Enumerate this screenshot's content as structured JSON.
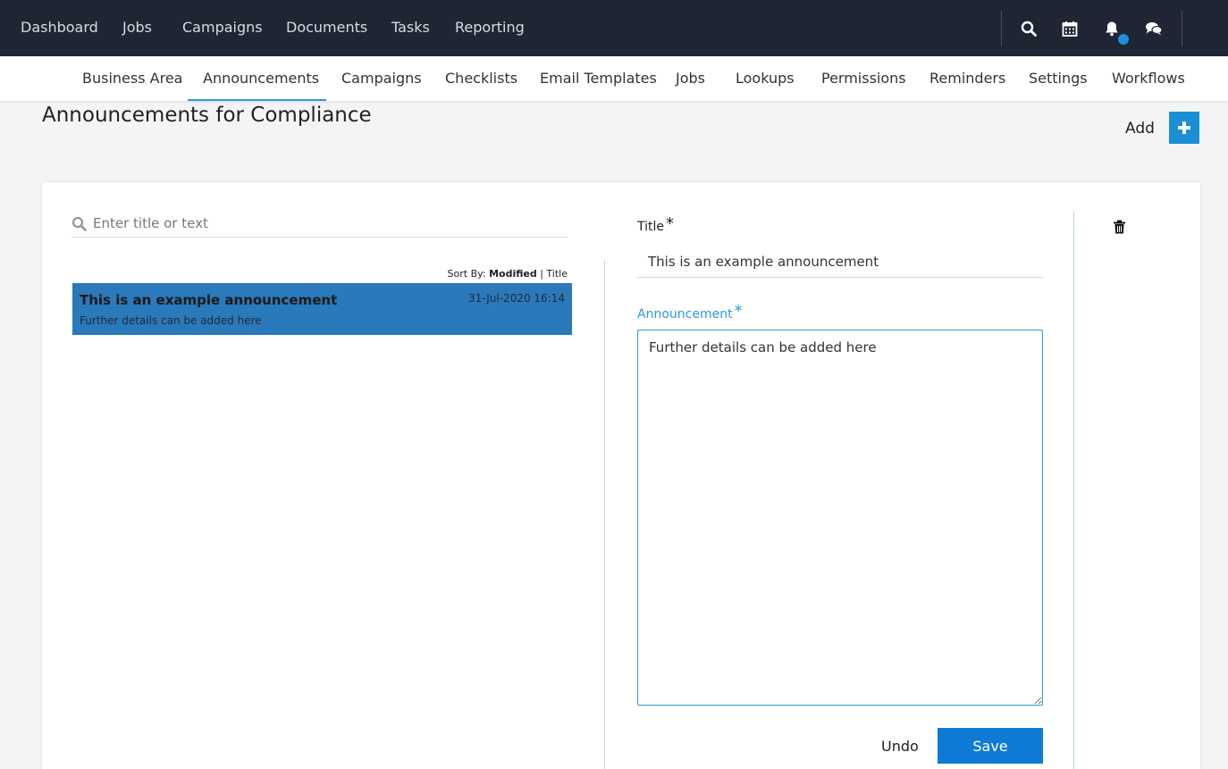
{
  "topnav": {
    "items": [
      "Dashboard",
      "Jobs",
      "Campaigns",
      "Documents",
      "Tasks",
      "Reporting"
    ],
    "icons": [
      "search-icon",
      "calendar-icon",
      "bell-icon",
      "chat-icon"
    ],
    "notification_color": "#1b8fe0"
  },
  "subnav": {
    "items": [
      "Business Area",
      "Announcements",
      "Campaigns",
      "Checklists",
      "Email Templates",
      "Jobs",
      "Lookups",
      "Permissions",
      "Reminders",
      "Settings",
      "Workflows"
    ],
    "active": "Announcements"
  },
  "page": {
    "title": "Announcements for Compliance",
    "add_label": "Add"
  },
  "list": {
    "search_placeholder": "Enter title or text",
    "sort_prefix": "Sort By:",
    "sort_modified": "Modified",
    "sort_separator": "|",
    "sort_title": "Title",
    "items": [
      {
        "title": "This is an example announcement",
        "summary": "Further details can be added here",
        "date": "31-Jul-2020 16:14"
      }
    ]
  },
  "editor": {
    "title_label": "Title",
    "title_value": "This is an example announcement",
    "announcement_label": "Announcement",
    "announcement_value": "Further details can be added here",
    "required_mark": "*",
    "undo_label": "Undo",
    "save_label": "Save"
  },
  "colors": {
    "accent": "#2a9ad8",
    "selected_row": "#2a79bb",
    "save_button": "#0f7ad6",
    "topbar": "#1f2533"
  }
}
